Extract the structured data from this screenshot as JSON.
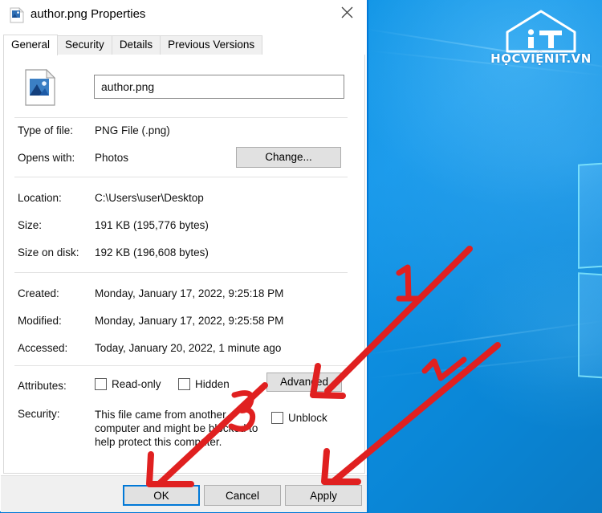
{
  "window": {
    "title": "author.png Properties",
    "title_icon": "png-file-icon",
    "close_label": "✕"
  },
  "tabs": [
    {
      "label": "General",
      "active": true
    },
    {
      "label": "Security",
      "active": false
    },
    {
      "label": "Details",
      "active": false
    },
    {
      "label": "Previous Versions",
      "active": false
    }
  ],
  "general": {
    "file_icon": "image-file-icon",
    "filename": "author.png",
    "rows": [
      {
        "label": "Type of file:",
        "value": "PNG File (.png)"
      },
      {
        "label": "Opens with:",
        "value": "Photos"
      },
      {
        "label": "Location:",
        "value": "C:\\Users\\user\\Desktop"
      },
      {
        "label": "Size:",
        "value": "191 KB (195,776 bytes)"
      },
      {
        "label": "Size on disk:",
        "value": "192 KB (196,608 bytes)"
      },
      {
        "label": "Created:",
        "value": "Monday, January 17, 2022, 9:25:18 PM"
      },
      {
        "label": "Modified:",
        "value": "Monday, January 17, 2022, 9:25:58 PM"
      },
      {
        "label": "Accessed:",
        "value": "Today, January 20, 2022, 1 minute ago"
      }
    ],
    "change_button": "Change...",
    "attributes_label": "Attributes:",
    "readonly_label": "Read-only",
    "hidden_label": "Hidden",
    "advanced_button": "Advanced",
    "security_label": "Security:",
    "security_text": "This file came from another computer and might be blocked to help protect this computer.",
    "unblock_label": "Unblock"
  },
  "footer": {
    "ok": "OK",
    "cancel": "Cancel",
    "apply": "Apply"
  },
  "watermark": {
    "brand": "HỌCVIỆNIT.VN",
    "mark": "iT",
    "icon": "house-logo-icon"
  },
  "annotations": {
    "one": "1",
    "two": "2",
    "three": "3",
    "color": "#e02020"
  },
  "theme": {
    "accent": "#0078d7",
    "desktop_blue": "#0d93e4",
    "dialog_bg": "#ffffff",
    "button_face": "#e1e1e1"
  }
}
